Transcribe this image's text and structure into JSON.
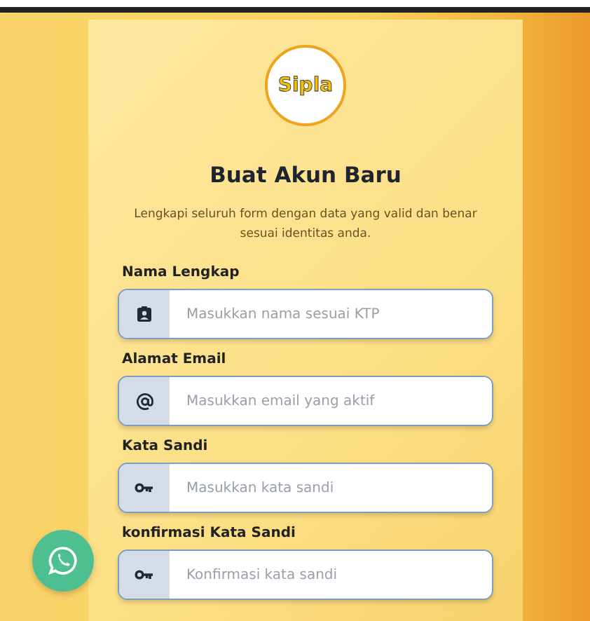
{
  "logo": {
    "text": "Sipla"
  },
  "title": "Buat Akun Baru",
  "subtitle": "Lengkapi seluruh form dengan data yang valid dan benar sesuai identitas anda.",
  "fields": [
    {
      "label": "Nama Lengkap",
      "kind": "person",
      "placeholder": "Masukkan nama sesuai KTP"
    },
    {
      "label": "Alamat Email",
      "kind": "email",
      "placeholder": "Masukkan email yang aktif"
    },
    {
      "label": "Kata Sandi",
      "kind": "key",
      "placeholder": "Masukkan kata sandi"
    },
    {
      "label": "konfirmasi Kata Sandi",
      "kind": "key",
      "placeholder": "Konfirmasi kata sandi"
    }
  ],
  "whatsapp_button": {
    "kind": "chat"
  }
}
